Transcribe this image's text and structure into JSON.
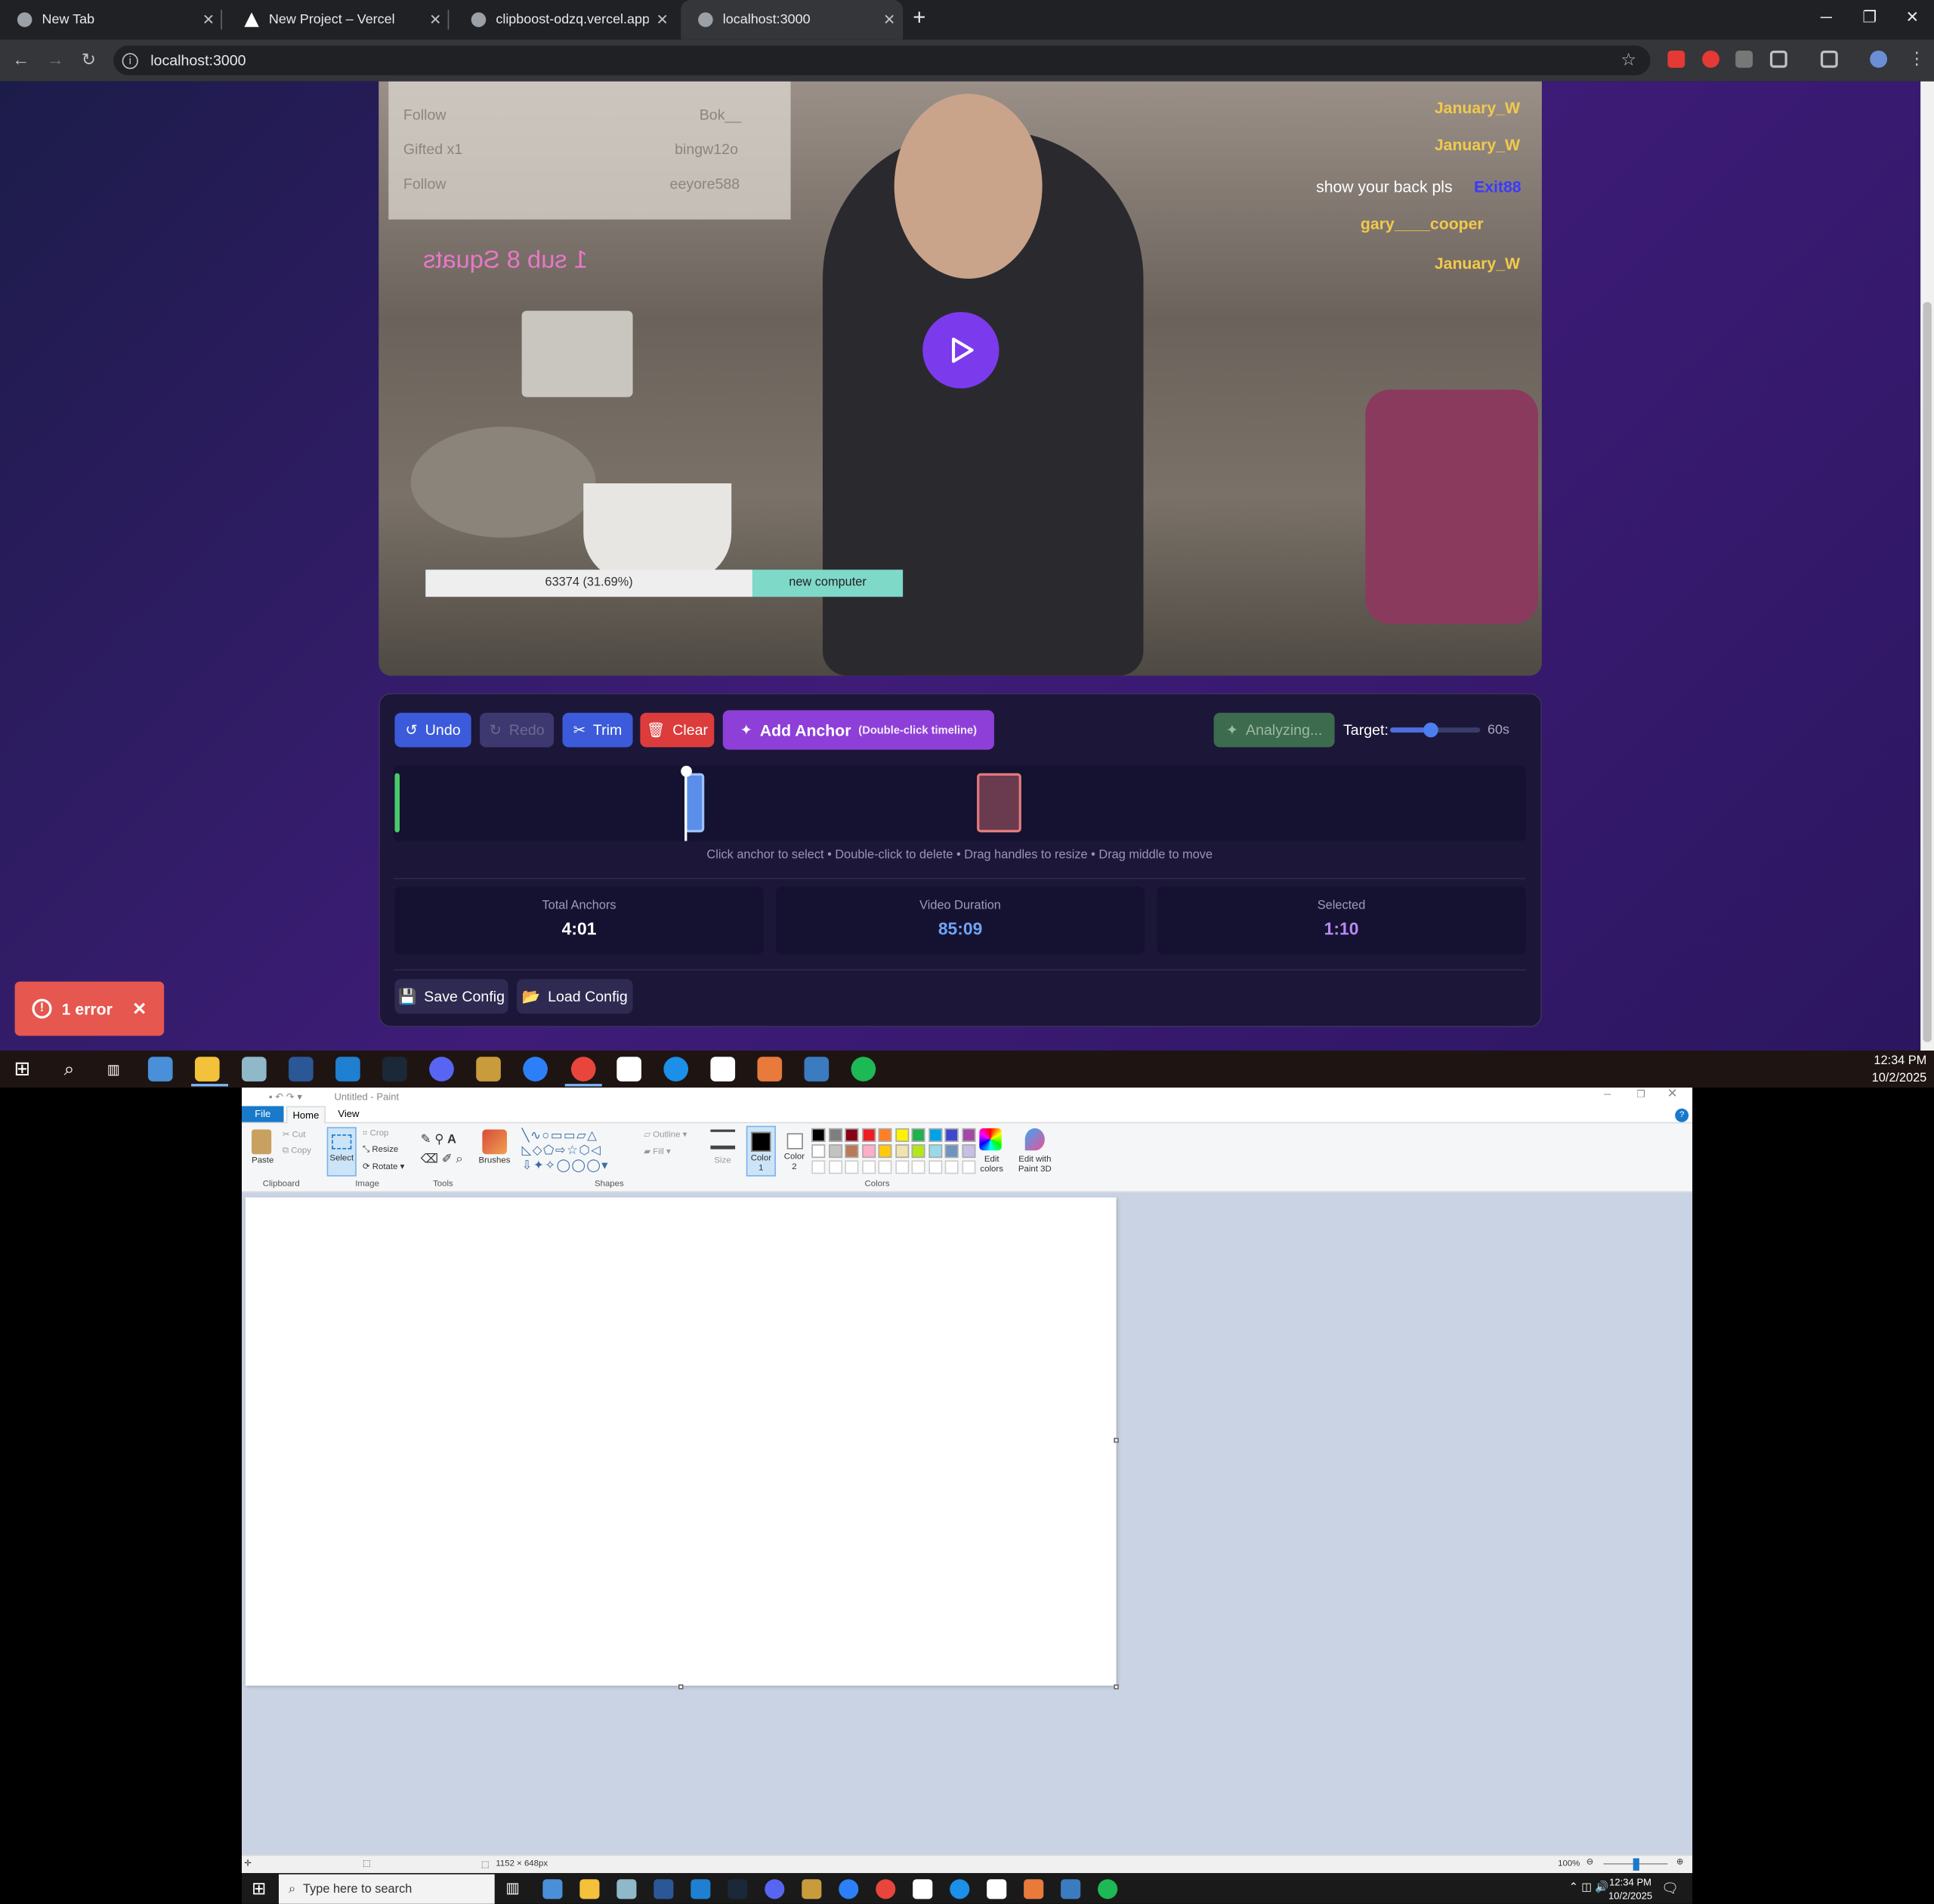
{
  "browser": {
    "tabs": [
      {
        "title": "New Tab"
      },
      {
        "title": "New Project – Vercel"
      },
      {
        "title": "clipboost-odzq.vercel.app"
      },
      {
        "title": "localhost:3000"
      }
    ],
    "url": "localhost:3000"
  },
  "video": {
    "overlay_texts": [
      "January_W",
      "January_W",
      "show your back pls",
      "Exit88",
      "gary____cooper",
      "January_W",
      "Follow",
      "Gifted x1",
      "Follow",
      "Bok__",
      "bingw12o",
      "eeyore588",
      "1 sub 8 Squats",
      "63374 (31.69%)",
      "new computer"
    ]
  },
  "toolbar": {
    "undo": "Undo",
    "redo": "Redo",
    "trim": "Trim",
    "clear": "Clear",
    "add_anchor": "Add Anchor",
    "add_anchor_hint": "(Double-click timeline)",
    "analyzing": "Analyzing...",
    "target_label": "Target:",
    "target_value": "60s",
    "target_fraction": 0.45
  },
  "timeline": {
    "hint": "Click anchor to select • Double-click to delete • Drag handles to resize • Drag middle to move"
  },
  "stats": [
    {
      "label": "Total Anchors",
      "value": "4:01"
    },
    {
      "label": "Video Duration",
      "value": "85:09"
    },
    {
      "label": "Selected",
      "value": "1:10"
    }
  ],
  "config": {
    "save": "Save Config",
    "load": "Load Config"
  },
  "error_toast": {
    "text": "1 error"
  },
  "taskbar": {
    "time": "12:34 PM",
    "date": "10/2/2025"
  },
  "paint": {
    "title": "Untitled - Paint",
    "tabs": [
      "File",
      "Home",
      "View"
    ],
    "clipboard": {
      "paste": "Paste",
      "cut": "Cut",
      "copy": "Copy",
      "group": "Clipboard"
    },
    "image": {
      "select": "Select",
      "crop": "Crop",
      "resize": "Resize",
      "rotate": "Rotate",
      "group": "Image"
    },
    "tools_group": "Tools",
    "brushes": "Brushes",
    "shapes": {
      "outline": "Outline",
      "fill": "Fill",
      "group": "Shapes"
    },
    "size": "Size",
    "color1": "Color 1",
    "color2": "Color 2",
    "colors_group": "Colors",
    "edit_colors": "Edit colors",
    "edit_3d": "Edit with Paint 3D",
    "status_size": "1152 × 648px",
    "zoom": "100%",
    "palette": [
      "#000000",
      "#7f7f7f",
      "#880015",
      "#ed1c24",
      "#ff7f27",
      "#fff200",
      "#22b14c",
      "#00a2e8",
      "#3f48cc",
      "#a349a4",
      "#ffffff",
      "#c3c3c3",
      "#b97a57",
      "#ffaec9",
      "#ffc90e",
      "#efe4b0",
      "#b5e61d",
      "#99d9ea",
      "#7092be",
      "#c8bfe7"
    ]
  },
  "taskbar2": {
    "search": "Type here to search",
    "time": "12:34 PM",
    "date": "10/2/2025"
  }
}
